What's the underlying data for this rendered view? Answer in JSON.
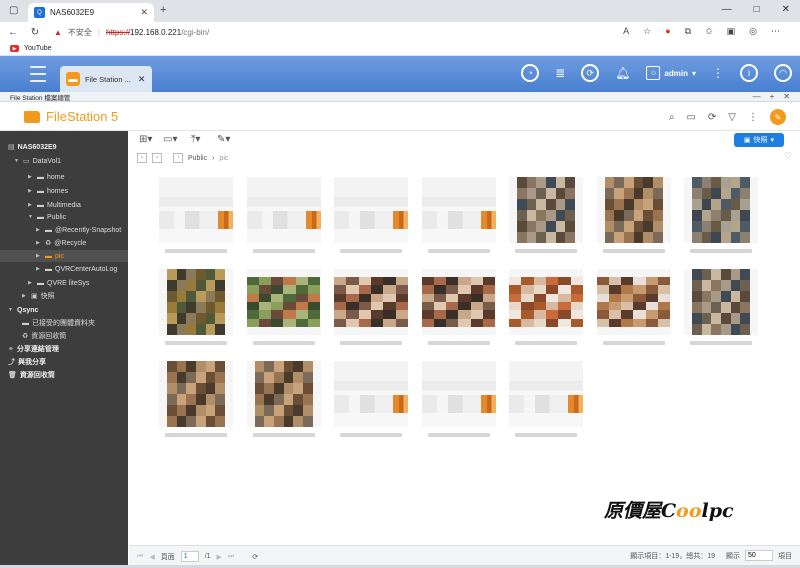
{
  "browser": {
    "tab_title": "NAS6032E9",
    "tab_favicon": "nas-icon",
    "security_label": "不安全",
    "url_protocol": "https://",
    "url_host": "192.168.0.221",
    "url_path": "/cgi-bin/",
    "bookmark": "YouTube"
  },
  "qts": {
    "app_tab_label": "File Station ...",
    "user": "admin"
  },
  "window": {
    "title": "File Station 檔案總管"
  },
  "fs": {
    "logo_text": "FileStation 5",
    "quick_button": "快照"
  },
  "sidebar": {
    "items": [
      {
        "label": "NAS6032E9"
      },
      {
        "label": "DataVol1"
      },
      {
        "label": "home"
      },
      {
        "label": "homes"
      },
      {
        "label": "Multimedia"
      },
      {
        "label": "Public"
      },
      {
        "label": "@Recently-Snapshot"
      },
      {
        "label": "@Recycle"
      },
      {
        "label": "pic"
      },
      {
        "label": "QVRCenterAutoLog"
      },
      {
        "label": "QVRE liteSys"
      },
      {
        "label": "快照"
      },
      {
        "label": "Qsync"
      },
      {
        "label": "已接受的團體資料夾"
      },
      {
        "label": "資源回收筒"
      },
      {
        "label": "分享連結管理"
      },
      {
        "label": "與我分享"
      },
      {
        "label": "資源回收筒"
      }
    ]
  },
  "breadcrumb": {
    "root": "Public",
    "current": "pic"
  },
  "files": {
    "count": 19
  },
  "footer": {
    "page_label": "頁面",
    "page_value": "1",
    "page_total": "/1",
    "display_range": "顯示項目：1-19，總共：19",
    "show_label": "顯示",
    "per_page": "50",
    "items_label": "項目"
  },
  "watermark": {
    "prefix": "原價屋",
    "c": "C",
    "oo": "oo",
    "suffix": "lpc"
  },
  "colors": {
    "accent": "#f29a1d",
    "topbar": "#5b8ed9",
    "sidebar": "#3d3d3d",
    "primary_button": "#1e7ee0"
  }
}
